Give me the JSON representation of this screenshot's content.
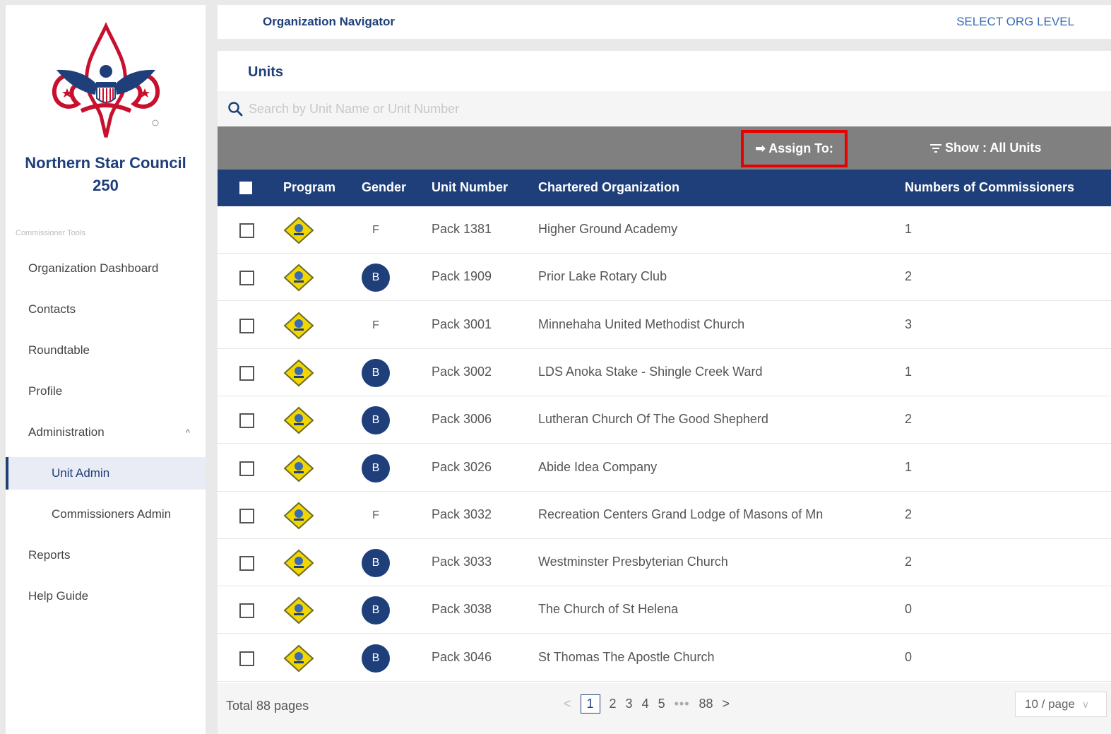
{
  "sidebar": {
    "council_name_line1": "Northern Star Council",
    "council_name_line2": "250",
    "section_caption": "Commissioner Tools",
    "items": [
      {
        "label": "Organization Dashboard"
      },
      {
        "label": "Contacts"
      },
      {
        "label": "Roundtable"
      },
      {
        "label": "Profile"
      },
      {
        "label": "Administration",
        "expanded": true
      },
      {
        "label": "Unit Admin",
        "active": true
      },
      {
        "label": "Commissioners Admin"
      },
      {
        "label": "Reports"
      },
      {
        "label": "Help Guide"
      }
    ]
  },
  "topbar": {
    "title": "Organization Navigator",
    "select_org_level": "SELECT ORG LEVEL"
  },
  "units": {
    "title": "Units",
    "search_placeholder": "Search by Unit Name or Unit Number",
    "assign_label": "Assign To:",
    "show_label": "Show : All Units",
    "columns": [
      "Program",
      "Gender",
      "Unit Number",
      "Chartered Organization",
      "Numbers of Commissioners"
    ],
    "rows": [
      {
        "gender": "F",
        "unit": "Pack 1381",
        "org": "Higher Ground Academy",
        "commissioners": "1"
      },
      {
        "gender": "B",
        "unit": "Pack 1909",
        "org": "Prior Lake Rotary Club",
        "commissioners": "2"
      },
      {
        "gender": "F",
        "unit": "Pack 3001",
        "org": "Minnehaha United Methodist Church",
        "commissioners": "3"
      },
      {
        "gender": "B",
        "unit": "Pack 3002",
        "org": "LDS Anoka Stake - Shingle Creek Ward",
        "commissioners": "1"
      },
      {
        "gender": "B",
        "unit": "Pack 3006",
        "org": "Lutheran Church Of The Good Shepherd",
        "commissioners": "2"
      },
      {
        "gender": "B",
        "unit": "Pack 3026",
        "org": "Abide Idea Company",
        "commissioners": "1"
      },
      {
        "gender": "F",
        "unit": "Pack 3032",
        "org": "Recreation Centers Grand Lodge of Masons of Mn",
        "commissioners": "2"
      },
      {
        "gender": "B",
        "unit": "Pack 3033",
        "org": "Westminster Presbyterian Church",
        "commissioners": "2"
      },
      {
        "gender": "B",
        "unit": "Pack 3038",
        "org": "The Church of St Helena",
        "commissioners": "0"
      },
      {
        "gender": "B",
        "unit": "Pack 3046",
        "org": "St Thomas The Apostle Church",
        "commissioners": "0"
      }
    ]
  },
  "pagination": {
    "total": "Total 88 pages",
    "pages": [
      "1",
      "2",
      "3",
      "4",
      "5",
      "88"
    ],
    "current": "1",
    "page_size": "10 / page"
  },
  "colors": {
    "brand_blue": "#1f3f7a",
    "toolbar_gray": "#808080",
    "highlight_red": "#e60000",
    "badge_yellow": "#f2d600"
  }
}
